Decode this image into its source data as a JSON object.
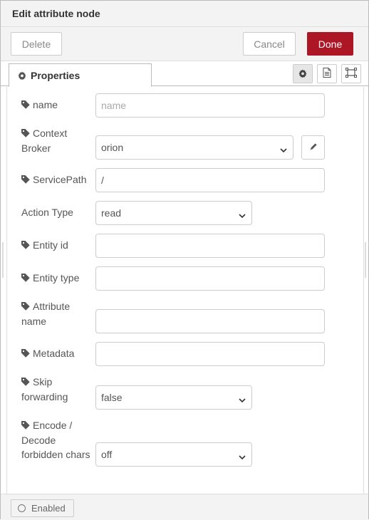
{
  "header": {
    "title": "Edit attribute node"
  },
  "toolbar": {
    "delete_label": "Delete",
    "cancel_label": "Cancel",
    "done_label": "Done"
  },
  "tabs": {
    "properties_label": "Properties"
  },
  "form": {
    "name": {
      "label": "name",
      "value": "",
      "placeholder": "name"
    },
    "context_broker": {
      "label_line1": "Context",
      "label_line2": "Broker",
      "value": "orion"
    },
    "service_path": {
      "label": "ServicePath",
      "value": "/"
    },
    "action_type": {
      "label": "Action Type",
      "value": "read"
    },
    "entity_id": {
      "label": "Entity id",
      "value": ""
    },
    "entity_type": {
      "label": "Entity type",
      "value": ""
    },
    "attribute_name": {
      "label_line1": "Attribute",
      "label_line2": "name",
      "value": ""
    },
    "metadata": {
      "label": "Metadata",
      "value": ""
    },
    "skip_forwarding": {
      "label_line1": "Skip",
      "label_line2": "forwarding",
      "value": "false"
    },
    "encode_decode": {
      "label_line1": "Encode /",
      "label_line2": "Decode",
      "label_line3": "forbidden chars",
      "value": "off"
    }
  },
  "footer": {
    "enabled_label": "Enabled"
  },
  "colors": {
    "done_button": "#ad1625",
    "header_bg": "#f3f3f3",
    "border": "#cccccc"
  }
}
